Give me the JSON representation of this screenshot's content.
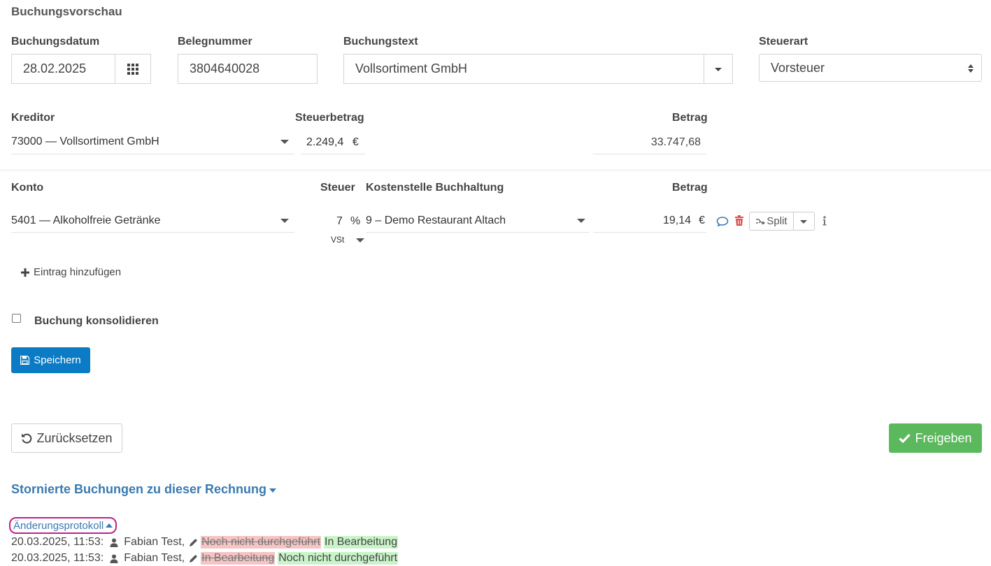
{
  "page_title": "Buchungsvorschau",
  "header_fields": {
    "buchungsdatum": {
      "label": "Buchungsdatum",
      "value": "28.02.2025"
    },
    "belegnummer": {
      "label": "Belegnummer",
      "value": "3804640028"
    },
    "buchungstext": {
      "label": "Buchungstext",
      "value": "Vollsortiment GmbH"
    },
    "steuerart": {
      "label": "Steuerart",
      "value": "Vorsteuer"
    }
  },
  "kreditor_row": {
    "kreditor": {
      "label": "Kreditor",
      "value": "73000 — Vollsortiment GmbH"
    },
    "steuerbetrag": {
      "label": "Steuerbetrag",
      "value": "2.249,4",
      "currency": "€"
    },
    "betrag": {
      "label": "Betrag",
      "value": "33.747,68"
    }
  },
  "positions": {
    "headers": {
      "konto": "Konto",
      "steuer": "Steuer",
      "kostenstelle": "Kostenstelle Buchhaltung",
      "betrag": "Betrag"
    },
    "row": {
      "konto": "5401 — Alkoholfreie Getränke",
      "steuer_value": "7",
      "steuer_unit": "%",
      "steuer_type": "VSt",
      "kostenstelle": "9 – Demo Restaurant Altach",
      "betrag": "19,14",
      "currency": "€",
      "split_label": "Split"
    }
  },
  "add_entry_label": "Eintrag hinzufügen",
  "consolidate_label": "Buchung konsolidieren",
  "save_label": "Speichern",
  "reset_label": "Zurücksetzen",
  "approve_label": "Freigeben",
  "storno_link": "Stornierte Buchungen zu dieser Rechnung",
  "changelog": {
    "title": "Änderungsprotokoll",
    "entries": [
      {
        "time": "20.03.2025, 11:53:",
        "user": "Fabian Test,",
        "old": "Noch nicht durchgeführt",
        "new": "In Bearbeitung"
      },
      {
        "time": "20.03.2025, 11:53:",
        "user": "Fabian Test,",
        "old": "In Bearbeitung",
        "new": "Noch nicht durchgeführt"
      }
    ]
  },
  "colors": {
    "primary": "#0a7bc4",
    "success": "#5cb85c",
    "link": "#3a7ab0",
    "danger": "#d9534f",
    "highlight_ring": "#c0208a"
  }
}
